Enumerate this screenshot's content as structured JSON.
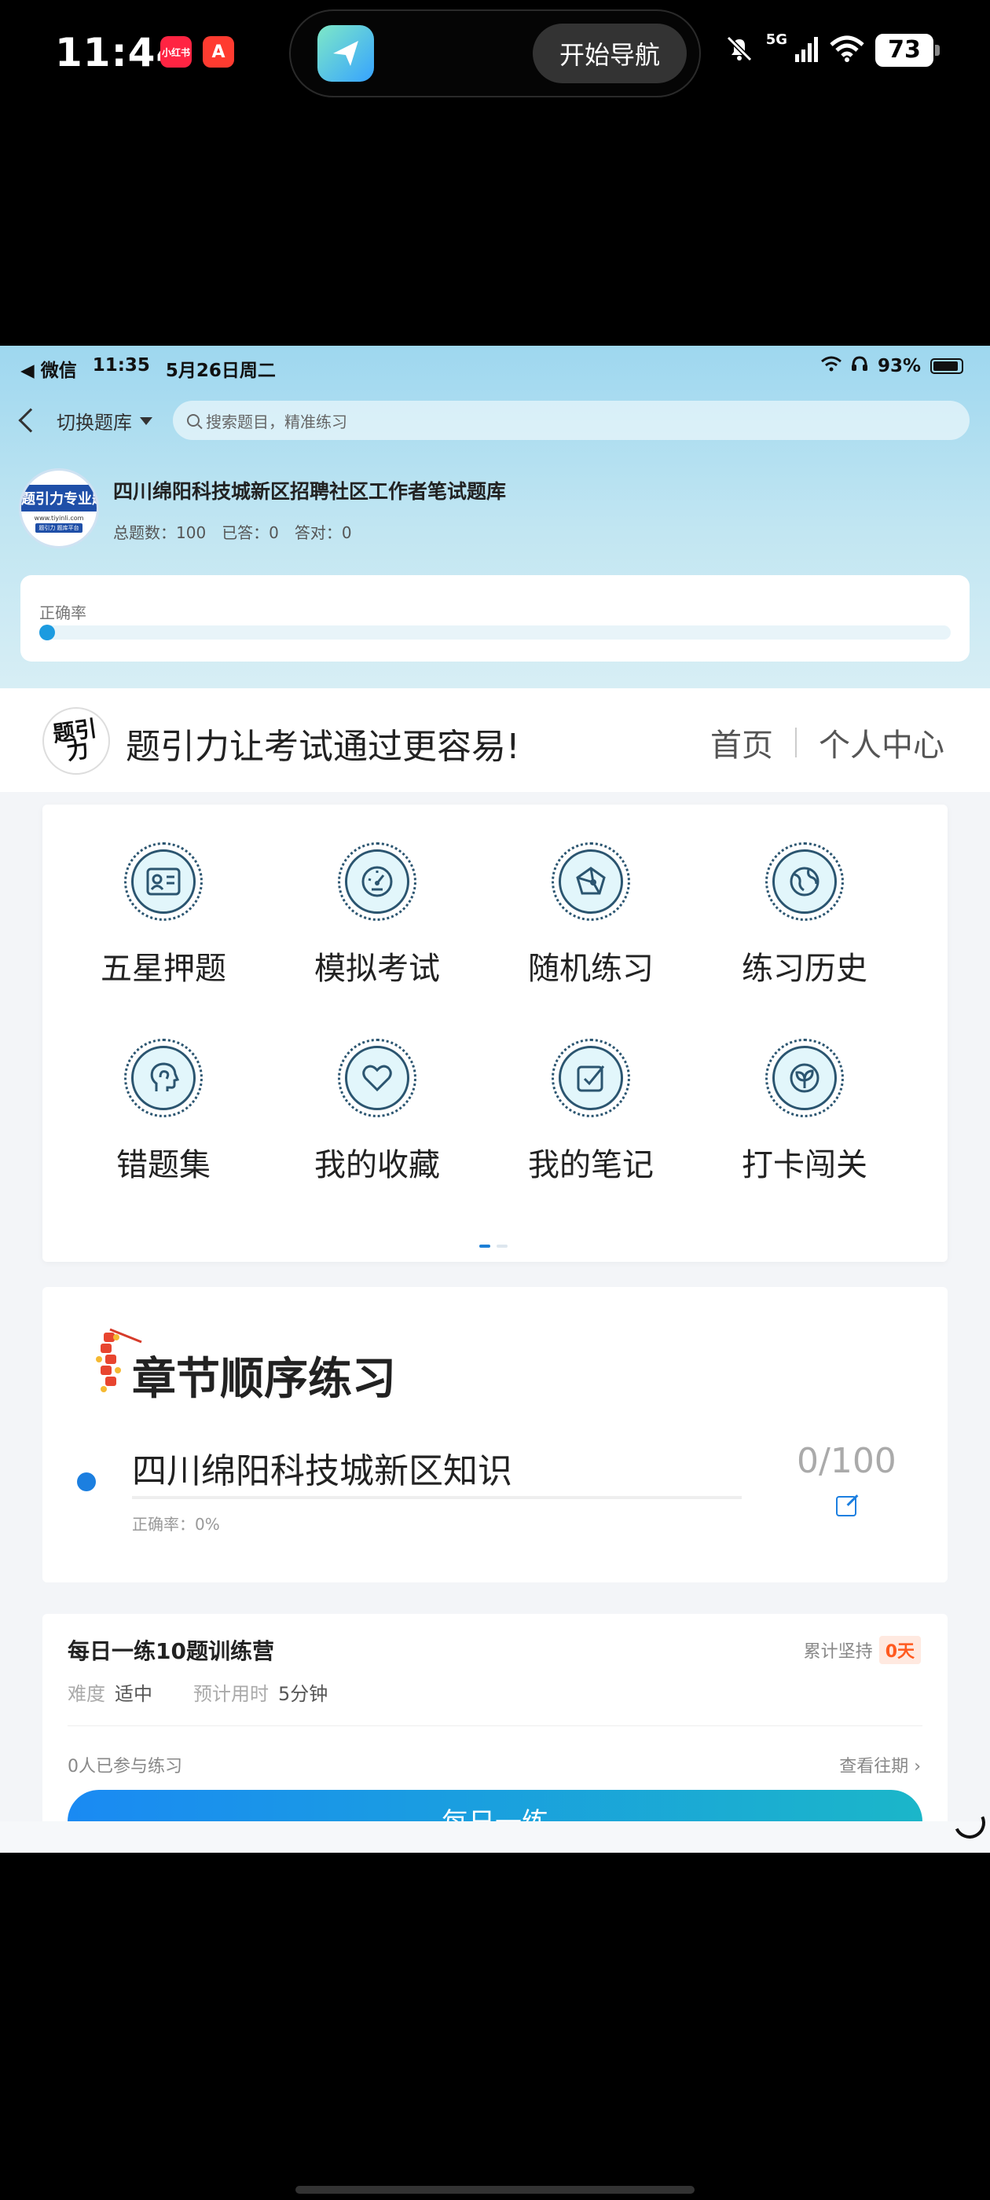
{
  "outer_status": {
    "time": "11:44",
    "app_badge_1": "小红书",
    "app_badge_2": "A",
    "nav_button": "开始导航",
    "network": "5G",
    "battery": "73"
  },
  "inner_status": {
    "back_app": "◀ 微信",
    "time": "11:35",
    "date": "5月26日周二",
    "battery": "93%"
  },
  "header": {
    "switch_label": "切换题库",
    "search_placeholder": "搜索题目，精准练习"
  },
  "bank": {
    "logo_text": "题引力专业题库",
    "logo_url": "www.tiyinli.com",
    "logo_tag": "题引力 题库平台",
    "title": "四川绵阳科技城新区招聘社区工作者笔试题库",
    "total": "总题数：100",
    "answered": "已答：0",
    "correct": "答对：0"
  },
  "accuracy": {
    "label": "正确率",
    "value": 0
  },
  "brand": {
    "logo_text": "题引力",
    "slogan": "题引力让考试通过更容易!",
    "nav": [
      "首页",
      "个人中心"
    ]
  },
  "features": [
    {
      "label": "五星押题",
      "icon": "id-card-icon"
    },
    {
      "label": "模拟考试",
      "icon": "gauge-icon"
    },
    {
      "label": "随机练习",
      "icon": "network-icon"
    },
    {
      "label": "练习历史",
      "icon": "globe-icon"
    },
    {
      "label": "错题集",
      "icon": "head-icon"
    },
    {
      "label": "我的收藏",
      "icon": "heart-icon"
    },
    {
      "label": "我的笔记",
      "icon": "note-check-icon"
    },
    {
      "label": "打卡闯关",
      "icon": "sprout-icon"
    }
  ],
  "chapter": {
    "title": "章节顺序练习",
    "item_name": "四川绵阳科技城新区知识",
    "item_accuracy": "正确率：0%",
    "item_count": "0/100",
    "progress": 0
  },
  "daily": {
    "title": "每日一练10题训练营",
    "difficulty_label": "难度",
    "difficulty": "适中",
    "time_label": "预计用时",
    "time": "5分钟",
    "streak_label": "累计坚持",
    "streak_value": "0天",
    "participants": "0人已参与练习",
    "history": "查看往期 ›",
    "button": "每日一练"
  },
  "colors": {
    "accent": "#1c7fe0",
    "hero_top": "#9ed7ef",
    "icon_fill": "#e2f6fb",
    "streak": "#ff5a1f"
  }
}
